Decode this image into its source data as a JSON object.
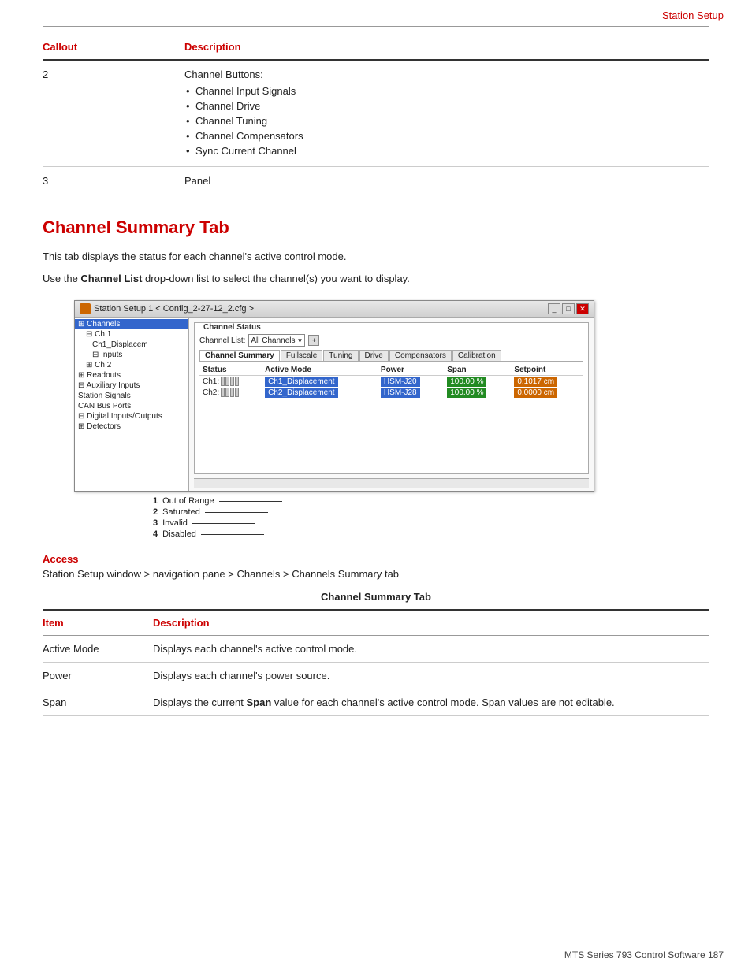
{
  "header": {
    "breadcrumb": "Station Setup"
  },
  "callout_table": {
    "col1": "Callout",
    "col2": "Description",
    "rows": [
      {
        "callout": "2",
        "description_label": "Channel Buttons:",
        "bullets": [
          "Channel Input Signals",
          "Channel Drive",
          "Channel Tuning",
          "Channel Compensators",
          "Sync Current Channel"
        ]
      },
      {
        "callout": "3",
        "description_label": "Panel",
        "bullets": []
      }
    ]
  },
  "section": {
    "heading": "Channel Summary Tab",
    "intro1": "This tab displays the status for each channel's active control mode.",
    "intro2_pre": "Use the ",
    "intro2_bold": "Channel List",
    "intro2_post": " drop-down list to select the channel(s) you want to display."
  },
  "sw_window": {
    "title": "Station Setup 1 < Config_2-27-12_2.cfg >",
    "nav_items": [
      {
        "label": "Channels",
        "indent": 0,
        "selected": true
      },
      {
        "label": "Ch 1",
        "indent": 1,
        "selected": false
      },
      {
        "label": "Ch1_Displacem",
        "indent": 2,
        "selected": false
      },
      {
        "label": "Inputs",
        "indent": 2,
        "selected": false
      },
      {
        "label": "Ch 2",
        "indent": 1,
        "selected": false
      },
      {
        "label": "Readouts",
        "indent": 0,
        "selected": false
      },
      {
        "label": "Auxiliary Inputs",
        "indent": 0,
        "selected": false
      },
      {
        "label": "Station Signals",
        "indent": 0,
        "selected": false
      },
      {
        "label": "CAN Bus Ports",
        "indent": 0,
        "selected": false
      },
      {
        "label": "Digital Inputs/Outputs",
        "indent": 0,
        "selected": false
      },
      {
        "label": "Detectors",
        "indent": 0,
        "selected": false
      }
    ],
    "channel_status": {
      "group_label": "Channel Status",
      "channel_list_label": "Channel List:",
      "channel_list_value": "All Channels",
      "tabs": [
        "Channel Summary",
        "Fullscale",
        "Tuning",
        "Drive",
        "Compensators",
        "Calibration"
      ],
      "active_tab": "Channel Summary",
      "table_headers": [
        "Status",
        "Active Mode",
        "Power",
        "Span",
        "Setpoint"
      ],
      "rows": [
        {
          "id": "Ch1:",
          "active_mode": "Ch1_Displacement",
          "power": "HSM-J20",
          "span": "100.00 %",
          "setpoint": "0.1017 cm"
        },
        {
          "id": "Ch2:",
          "active_mode": "Ch2_Displacement",
          "power": "HSM-J28",
          "span": "100.00 %",
          "setpoint": "0.0000 cm"
        }
      ]
    }
  },
  "annotations": [
    {
      "number": "1",
      "label": "Out of Range"
    },
    {
      "number": "2",
      "label": "Saturated"
    },
    {
      "number": "3",
      "label": "Invalid"
    },
    {
      "number": "4",
      "label": "Disabled"
    }
  ],
  "access": {
    "heading": "Access",
    "path": "Station Setup window > navigation pane > Channels > Channels Summary tab"
  },
  "bottom_table": {
    "title": "Channel Summary Tab",
    "col1": "Item",
    "col2": "Description",
    "rows": [
      {
        "item": "Active Mode",
        "description": "Displays each channel's active control mode."
      },
      {
        "item": "Power",
        "description": "Displays each channel's power source."
      },
      {
        "item": "Span",
        "description_pre": "Displays the current ",
        "description_bold": "Span",
        "description_post": " value for each channel's active control mode. Span values are not editable."
      }
    ]
  },
  "footer": {
    "text": "MTS Series 793 Control Software   187"
  }
}
